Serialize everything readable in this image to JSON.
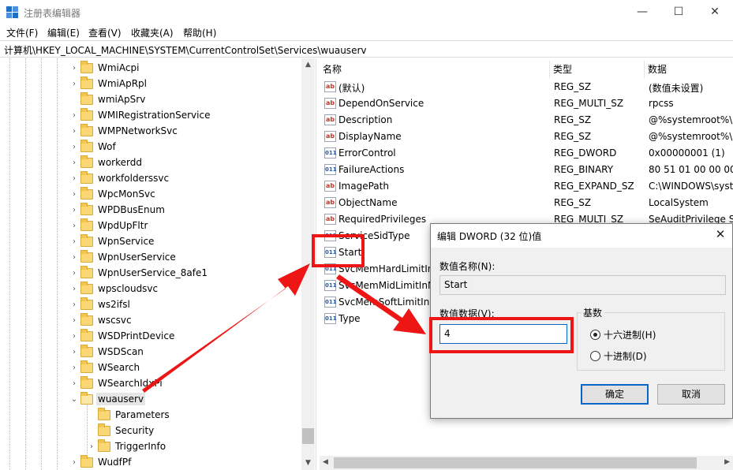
{
  "window": {
    "title": "注册表编辑器",
    "controls": {
      "minimize": "—",
      "maximize": "☐",
      "close": "✕"
    }
  },
  "menu": [
    "文件(F)",
    "编辑(E)",
    "查看(V)",
    "收藏夹(A)",
    "帮助(H)"
  ],
  "address": "计算机\\HKEY_LOCAL_MACHINE\\SYSTEM\\CurrentControlSet\\Services\\wuauserv",
  "tree": {
    "items": [
      {
        "label": "WmiAcpi",
        "has_children": true
      },
      {
        "label": "WmiApRpl",
        "has_children": true
      },
      {
        "label": "wmiApSrv",
        "has_children": false
      },
      {
        "label": "WMIRegistrationService",
        "has_children": true
      },
      {
        "label": "WMPNetworkSvc",
        "has_children": true
      },
      {
        "label": "Wof",
        "has_children": true
      },
      {
        "label": "workerdd",
        "has_children": true
      },
      {
        "label": "workfolderssvc",
        "has_children": true
      },
      {
        "label": "WpcMonSvc",
        "has_children": true
      },
      {
        "label": "WPDBusEnum",
        "has_children": true
      },
      {
        "label": "WpdUpFltr",
        "has_children": true
      },
      {
        "label": "WpnService",
        "has_children": true
      },
      {
        "label": "WpnUserService",
        "has_children": true
      },
      {
        "label": "WpnUserService_8afe1",
        "has_children": true
      },
      {
        "label": "wpscloudsvc",
        "has_children": true
      },
      {
        "label": "ws2ifsl",
        "has_children": true
      },
      {
        "label": "wscsvc",
        "has_children": true
      },
      {
        "label": "WSDPrintDevice",
        "has_children": true
      },
      {
        "label": "WSDScan",
        "has_children": true
      },
      {
        "label": "WSearch",
        "has_children": true
      },
      {
        "label": "WSearchIdxPi",
        "has_children": true
      },
      {
        "label": "wuauserv",
        "has_children": true,
        "expanded": true,
        "selected": true
      },
      {
        "label": "Parameters",
        "has_children": false,
        "child": true
      },
      {
        "label": "Security",
        "has_children": false,
        "child": true
      },
      {
        "label": "TriggerInfo",
        "has_children": true,
        "child": true
      },
      {
        "label": "WudfPf",
        "has_children": true
      }
    ],
    "collapsed_arrow": "›",
    "expanded_arrow": "⌄"
  },
  "list": {
    "columns": {
      "name": "名称",
      "type": "类型",
      "data": "数据"
    },
    "rows": [
      {
        "icon": "ab",
        "name": "(默认)",
        "type": "REG_SZ",
        "data": "(数值未设置)"
      },
      {
        "icon": "ab",
        "name": "DependOnService",
        "type": "REG_MULTI_SZ",
        "data": "rpcss"
      },
      {
        "icon": "ab",
        "name": "Description",
        "type": "REG_SZ",
        "data": "@%systemroot%\\"
      },
      {
        "icon": "ab",
        "name": "DisplayName",
        "type": "REG_SZ",
        "data": "@%systemroot%\\"
      },
      {
        "icon": "bin",
        "name": "ErrorControl",
        "type": "REG_DWORD",
        "data": "0x00000001 (1)"
      },
      {
        "icon": "bin",
        "name": "FailureActions",
        "type": "REG_BINARY",
        "data": "80 51 01 00 00 00"
      },
      {
        "icon": "ab",
        "name": "ImagePath",
        "type": "REG_EXPAND_SZ",
        "data": "C:\\WINDOWS\\syst"
      },
      {
        "icon": "ab",
        "name": "ObjectName",
        "type": "REG_SZ",
        "data": "LocalSystem"
      },
      {
        "icon": "ab",
        "name": "RequiredPrivileges",
        "type": "REG_MULTI_SZ",
        "data": "SeAuditPrivilege S"
      },
      {
        "icon": "bin",
        "name": "ServiceSidType",
        "type": "",
        "data": ""
      },
      {
        "icon": "bin",
        "name": "Start",
        "type": "",
        "data": ""
      },
      {
        "icon": "bin",
        "name": "SvcMemHardLimitIn",
        "type": "",
        "data": ""
      },
      {
        "icon": "bin",
        "name": "SvcMemMidLimitInM",
        "type": "",
        "data": ""
      },
      {
        "icon": "bin",
        "name": "SvcMemSoftLimitInM",
        "type": "",
        "data": ""
      },
      {
        "icon": "bin",
        "name": "Type",
        "type": "",
        "data": ""
      }
    ],
    "icon_glyphs": {
      "ab": "ab",
      "bin": "011"
    }
  },
  "dialog": {
    "title": "编辑 DWORD (32 位)值",
    "close": "✕",
    "name_label": "数值名称(N):",
    "name_value": "Start",
    "data_label": "数值数据(V):",
    "data_value": "4",
    "radix_label": "基数",
    "hex_label": "十六进制(H)",
    "dec_label": "十进制(D)",
    "hex_selected": true,
    "ok": "确定",
    "cancel": "取消"
  },
  "annotation_color": "#ee1515"
}
